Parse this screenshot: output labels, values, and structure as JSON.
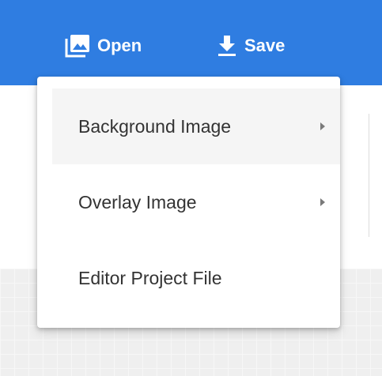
{
  "toolbar": {
    "open_label": "Open",
    "open_icon": "image-icon",
    "save_label": "Save",
    "save_icon": "download-icon",
    "background_color": "#2f7de1"
  },
  "menu": {
    "items": [
      {
        "label": "Background Image",
        "has_submenu": true,
        "highlighted": true
      },
      {
        "label": "Overlay Image",
        "has_submenu": true,
        "highlighted": false
      },
      {
        "label": "Editor Project File",
        "has_submenu": false,
        "highlighted": false
      }
    ],
    "submenu_icon": "caret-right-icon"
  }
}
